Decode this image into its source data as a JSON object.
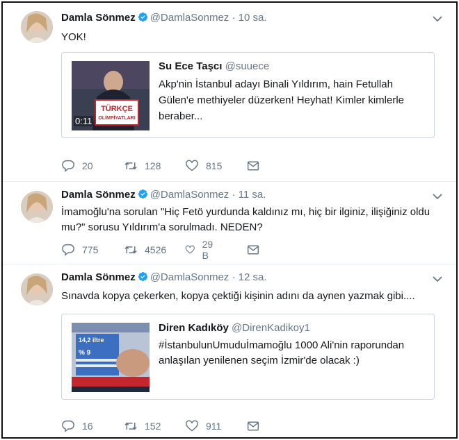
{
  "tweets": [
    {
      "name": "Damla Sönmez",
      "handle": "@DamlaSonmez",
      "dot": "·",
      "time": "10 sa.",
      "text": "YOK!",
      "quote": {
        "name": "Su Ece Taşcı",
        "handle": "@suuece",
        "text": "Akp'nin İstanbul adayı Binali Yıldırım, hain Fetullah Gülen'e methiyeler düzerken! Heyhat! Kimler kimlerle beraber...",
        "video_time": "0:11",
        "thumb_sign": "TÜRKÇE OLİMPİYATLARI"
      },
      "actions": {
        "replies": "20",
        "retweets": "128",
        "likes": "815"
      }
    },
    {
      "name": "Damla Sönmez",
      "handle": "@DamlaSonmez",
      "dot": "·",
      "time": "11 sa.",
      "text": "İmamoğlu'na sorulan \"Hiç Fetö yurdunda kaldınız mı, hiç bir ilginiz, ilişiğiniz oldu mu?\" sorusu Yıldırım'a sorulmadı. NEDEN?",
      "actions": {
        "replies": "775",
        "retweets": "4526",
        "likes": "29 B"
      }
    },
    {
      "name": "Damla Sönmez",
      "handle": "@DamlaSonmez",
      "dot": "·",
      "time": "12 sa.",
      "text": "Sınavda kopya çekerken, kopya çektiği kişinin adını da aynen yazmak gibi....",
      "quote": {
        "name": "Diren Kadıköy",
        "handle": "@DirenKadikoy1",
        "text": "#İstanbulunUmuduİmamoğlu 1000 Ali'nin raporundan anlaşılan yenilenen seçim İzmir'de olacak :)",
        "thumb_values": [
          "14,2 iltre",
          "% 9"
        ]
      },
      "actions": {
        "replies": "16",
        "retweets": "152",
        "likes": "911"
      }
    }
  ],
  "colors": {
    "verified": "#1da1f2",
    "muted": "#657786",
    "border": "#e6ecf0"
  },
  "icons": [
    "reply-icon",
    "retweet-icon",
    "like-icon",
    "direct-message-icon",
    "verified-badge-icon",
    "chevron-down-icon"
  ]
}
